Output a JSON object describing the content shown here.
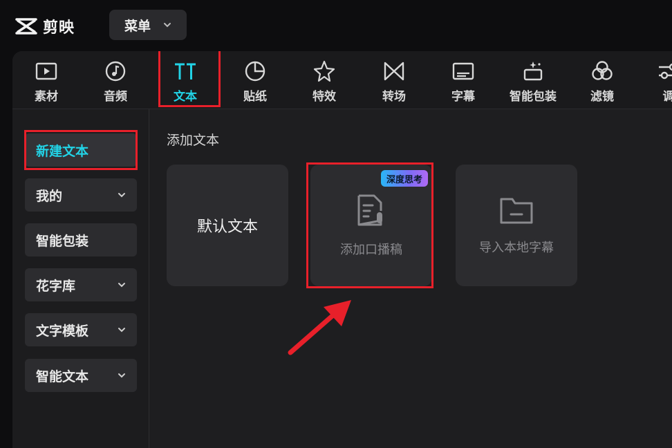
{
  "app": {
    "name": "剪映"
  },
  "menu": {
    "label": "菜单"
  },
  "toolbar": {
    "items": [
      {
        "label": "素材",
        "icon": "media-play-icon"
      },
      {
        "label": "音频",
        "icon": "audio-icon"
      },
      {
        "label": "文本",
        "icon": "text-tt-icon",
        "active": true
      },
      {
        "label": "贴纸",
        "icon": "sticker-icon"
      },
      {
        "label": "特效",
        "icon": "effects-star-icon"
      },
      {
        "label": "转场",
        "icon": "transition-icon"
      },
      {
        "label": "字幕",
        "icon": "subtitle-icon"
      },
      {
        "label": "智能包装",
        "icon": "smart-package-icon"
      },
      {
        "label": "滤镜",
        "icon": "filter-icon"
      },
      {
        "label": "调",
        "icon": "adjust-icon"
      }
    ]
  },
  "sidebar": {
    "items": [
      {
        "label": "新建文本",
        "active": true,
        "has_chevron": false
      },
      {
        "label": "我的",
        "has_chevron": true
      },
      {
        "label": "智能包装",
        "has_chevron": false
      },
      {
        "label": "花字库",
        "has_chevron": true
      },
      {
        "label": "文字模板",
        "has_chevron": true
      },
      {
        "label": "智能文本",
        "has_chevron": true
      }
    ]
  },
  "main": {
    "section_title": "添加文本",
    "cards": [
      {
        "label": "默认文本"
      },
      {
        "label": "添加口播稿",
        "badge": "深度思考",
        "icon": "script-mic-icon"
      },
      {
        "label": "导入本地字幕",
        "icon": "folder-icon"
      }
    ]
  },
  "colors": {
    "accent": "#22d3e6",
    "annotation_red": "#e8202a",
    "panel_bg": "#1e1e20",
    "card_bg": "#2c2c2f"
  }
}
